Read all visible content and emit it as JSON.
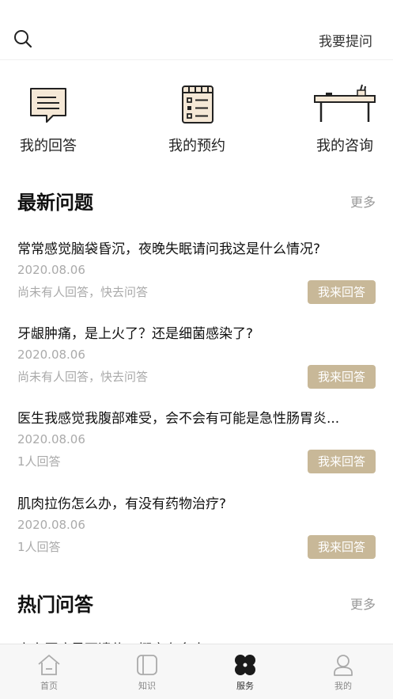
{
  "header": {
    "search_icon": "search-icon",
    "ask_label": "我要提问"
  },
  "shortcuts": [
    {
      "label": "我的回答",
      "icon": "chat-bubble-icon"
    },
    {
      "label": "我的预约",
      "icon": "calendar-icon"
    },
    {
      "label": "我的咨询",
      "icon": "desk-icon"
    }
  ],
  "latest": {
    "title": "最新问题",
    "more": "更多",
    "items": [
      {
        "title": "常常感觉脑袋昏沉，夜晚失眠请问我这是什么情况?",
        "date": "2020.08.06",
        "status": "尚未有人回答，快去问答",
        "button": "我来回答"
      },
      {
        "title": "牙龈肿痛，是上火了？还是细菌感染了?",
        "date": "2020.08.06",
        "status": "尚未有人回答，快去问答",
        "button": "我来回答"
      },
      {
        "title": "医生我感觉我腹部难受，会不会有可能是急性肠胃炎...",
        "date": "2020.08.06",
        "status": "1人回答",
        "button": "我来回答"
      },
      {
        "title": "肌肉拉伤怎么办，有没有药物治疗?",
        "date": "2020.08.06",
        "status": "1人回答",
        "button": "我来回答"
      }
    ]
  },
  "hot": {
    "title": "热门问答",
    "more": "更多",
    "partial_item": "高血压病是否遗传，概率有多大?"
  },
  "tabbar": {
    "tabs": [
      {
        "label": "首页",
        "icon": "home-icon"
      },
      {
        "label": "知识",
        "icon": "book-icon"
      },
      {
        "label": "服务",
        "icon": "clover-icon"
      },
      {
        "label": "我的",
        "icon": "user-icon"
      }
    ],
    "active_color": "#333333",
    "inactive_color": "#888888"
  },
  "colors": {
    "accent": "#c8b898",
    "muted_text": "#aaaaaa"
  }
}
